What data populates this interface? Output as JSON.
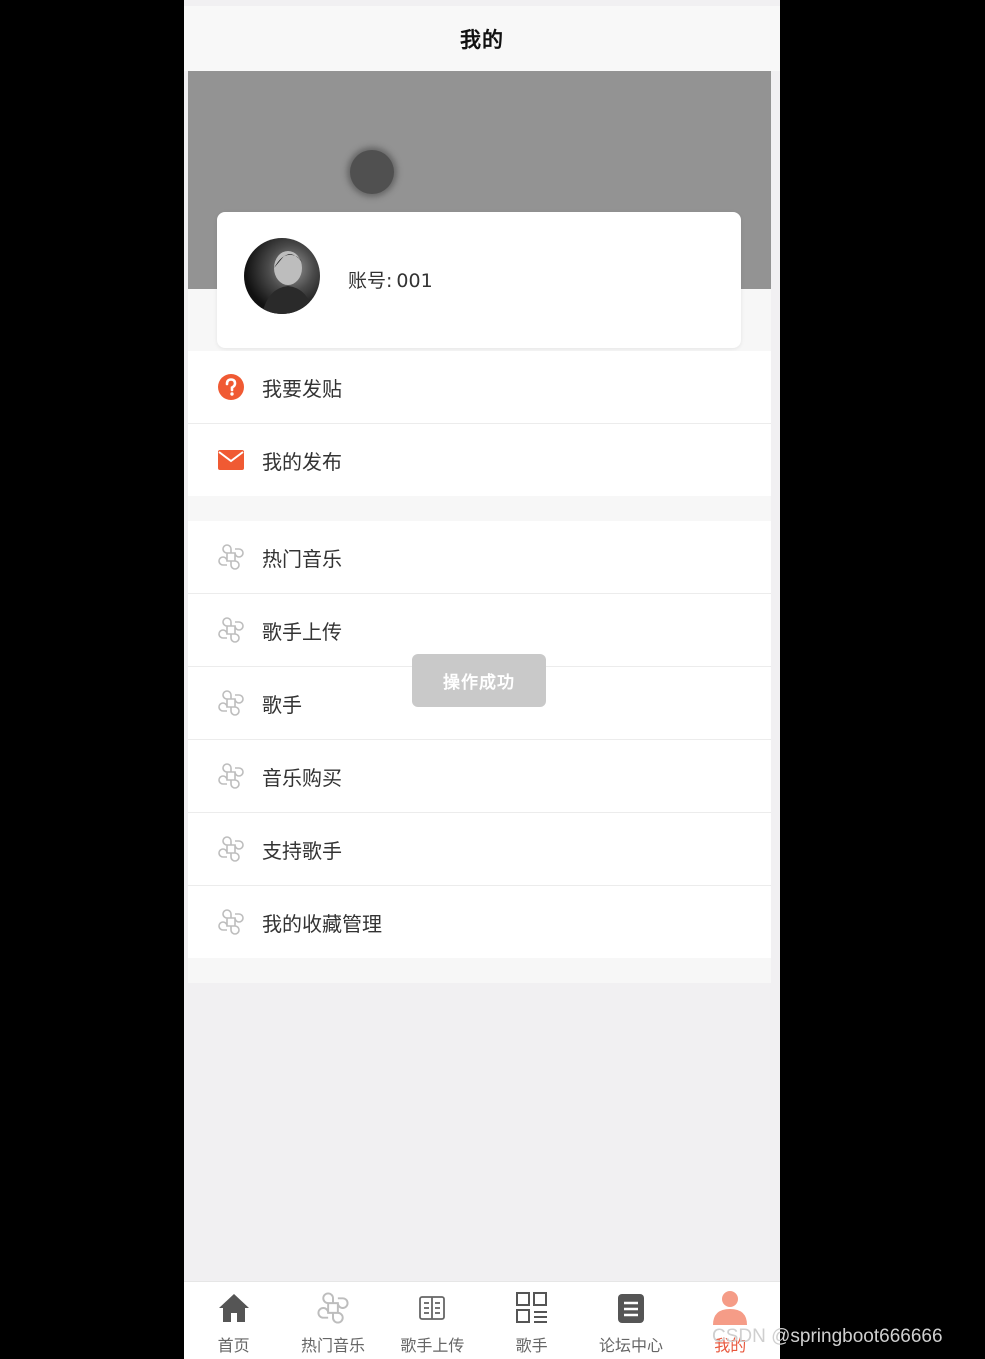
{
  "header": {
    "title": "我的"
  },
  "profile": {
    "account_label": "账号:",
    "account_value": "001"
  },
  "menu_group_1": [
    {
      "label": "我要发贴",
      "icon": "question-circle-icon"
    },
    {
      "label": "我的发布",
      "icon": "mail-icon"
    }
  ],
  "menu_group_2": [
    {
      "label": "热门音乐",
      "icon": "command-icon"
    },
    {
      "label": "歌手上传",
      "icon": "command-icon"
    },
    {
      "label": "歌手",
      "icon": "command-icon"
    },
    {
      "label": "音乐购买",
      "icon": "command-icon"
    },
    {
      "label": "支持歌手",
      "icon": "command-icon"
    },
    {
      "label": "我的收藏管理",
      "icon": "command-icon"
    }
  ],
  "toast": {
    "text": "操作成功"
  },
  "tabbar": {
    "items": [
      {
        "label": "首页",
        "icon": "home-icon"
      },
      {
        "label": "热门音乐",
        "icon": "command-icon"
      },
      {
        "label": "歌手上传",
        "icon": "book-icon"
      },
      {
        "label": "歌手",
        "icon": "grid-list-icon"
      },
      {
        "label": "论坛中心",
        "icon": "document-icon"
      },
      {
        "label": "我的",
        "icon": "person-icon"
      }
    ],
    "active_index": 5
  },
  "watermark": "CSDN @springboot666666",
  "colors": {
    "accent": "#e8573c",
    "icon_gray": "#b5b5b5",
    "banner": "#939393"
  }
}
